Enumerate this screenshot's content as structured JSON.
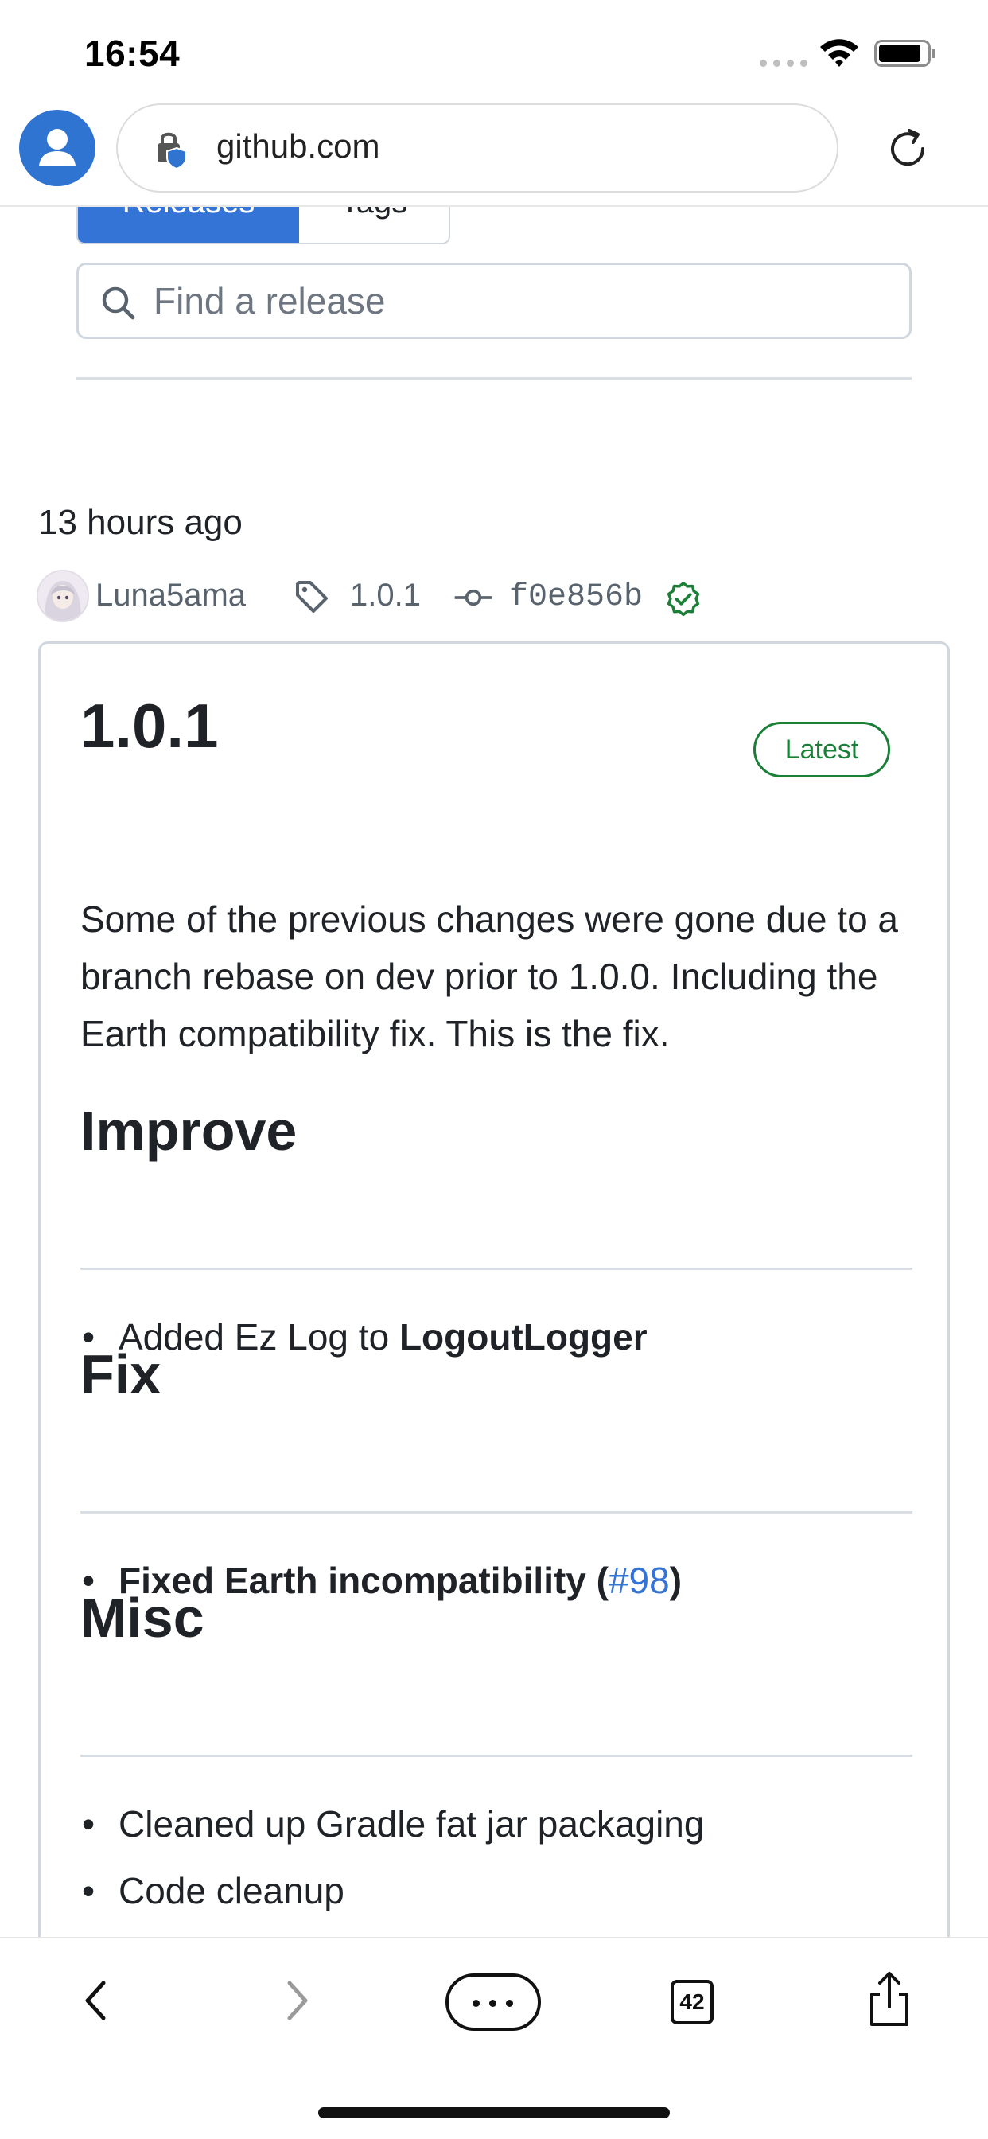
{
  "status_bar": {
    "time": "16:54"
  },
  "browser": {
    "url": "github.com",
    "tab_count": "42"
  },
  "release_nav": {
    "tabs": [
      {
        "label": "Releases"
      },
      {
        "label": "Tags"
      }
    ],
    "search_placeholder": "Find a release"
  },
  "release": {
    "time_ago": "13 hours ago",
    "author": "Luna5ama",
    "tag": "1.0.1",
    "commit": "f0e856b",
    "title": "1.0.1",
    "badge": "Latest",
    "description": "Some of the previous changes were gone due to a branch rebase on dev prior to 1.0.0. Including the Earth compatibility fix. This is the fix.",
    "sections": [
      {
        "heading": "Improve",
        "items": [
          {
            "prefix": "Added Ez Log to ",
            "bold": "LogoutLogger"
          }
        ]
      },
      {
        "heading": "Fix",
        "items": [
          {
            "bold": "Fixed Earth incompatibility (",
            "link": "#98",
            "suffix": ")"
          }
        ]
      },
      {
        "heading": "Misc",
        "items": [
          {
            "text": "Cleaned up Gradle fat jar packaging"
          },
          {
            "text": "Code cleanup"
          }
        ]
      }
    ]
  },
  "colors": {
    "accent": "#3474d6",
    "latest_green": "#1a7f37",
    "text": "#1f2328",
    "muted": "#59636e"
  }
}
